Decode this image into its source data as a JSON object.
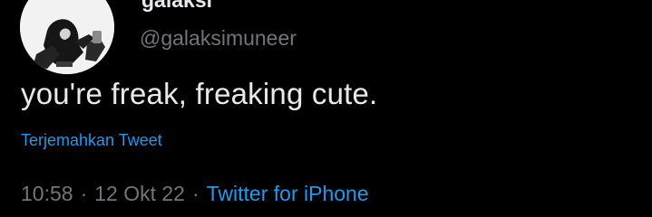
{
  "tweet": {
    "author": {
      "display_name": "galaksi",
      "handle": "@galaksimuneer"
    },
    "text": "you're freak, freaking cute.",
    "translate_label": "Terjemahkan Tweet",
    "meta": {
      "time": "10:58",
      "separator": "·",
      "date": "12 Okt 22",
      "source": "Twitter for iPhone"
    }
  },
  "colors": {
    "background": "#000000",
    "primary_text": "#e7e9ea",
    "secondary_text": "#71767b",
    "accent": "#1d9bf0"
  },
  "icons": {
    "more": "more-horizontal-icon"
  }
}
